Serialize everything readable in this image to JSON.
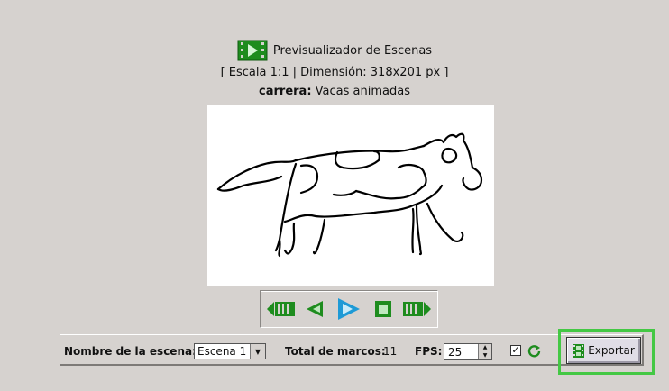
{
  "header": {
    "title": "Previsualizador de Escenas",
    "scale_info": "[ Escala 1:1 | Dimensión: 318x201 px ]",
    "animation_label": "carrera:",
    "animation_name": "Vacas animadas"
  },
  "player": {
    "buttons": [
      "rewind-icon",
      "previous-frame-icon",
      "play-icon",
      "stop-icon",
      "forward-icon"
    ]
  },
  "bottom_bar": {
    "scene_name_label": "Nombre de la escena:",
    "scene_selected": "Escena 1",
    "total_frames_label": "Total de marcos:",
    "total_frames_value": "11",
    "fps_label": "FPS:",
    "fps_value": "25",
    "loop_checked": true,
    "export_label": "Exportar"
  },
  "colors": {
    "accent_green": "#1e8c1e",
    "play_blue": "#1e9ad6",
    "focus_green": "#44c844"
  }
}
